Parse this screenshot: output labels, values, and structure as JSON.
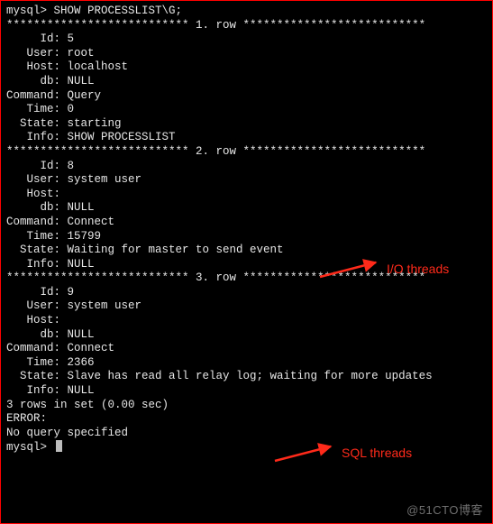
{
  "prompt1": "mysql> SHOW PROCESSLIST\\G;",
  "sep": {
    "r1": "*************************** 1. row ***************************",
    "r2": "*************************** 2. row ***************************",
    "r3": "*************************** 3. row ***************************"
  },
  "row1": {
    "Id": "     Id: 5",
    "User": "   User: root",
    "Host": "   Host: localhost",
    "db": "     db: NULL",
    "Command": "Command: Query",
    "Time": "   Time: 0",
    "State": "  State: starting",
    "Info": "   Info: SHOW PROCESSLIST"
  },
  "row2": {
    "Id": "     Id: 8",
    "User": "   User: system user",
    "Host": "   Host: ",
    "db": "     db: NULL",
    "Command": "Command: Connect",
    "Time": "   Time: 15799",
    "State": "  State: Waiting for master to send event",
    "Info": "   Info: NULL"
  },
  "row3": {
    "Id": "     Id: 9",
    "User": "   User: system user",
    "Host": "   Host: ",
    "db": "     db: NULL",
    "Command": "Command: Connect",
    "Time": "   Time: 2366",
    "State": "  State: Slave has read all relay log; waiting for more updates",
    "Info": "   Info: NULL"
  },
  "summary": "3 rows in set (0.00 sec)",
  "blank": "",
  "error_hdr": "ERROR:",
  "error_msg": "No query specified",
  "prompt2": "mysql> ",
  "annot": {
    "io": "I/O threads",
    "sql": "SQL threads"
  },
  "watermark": "@51CTO博客"
}
